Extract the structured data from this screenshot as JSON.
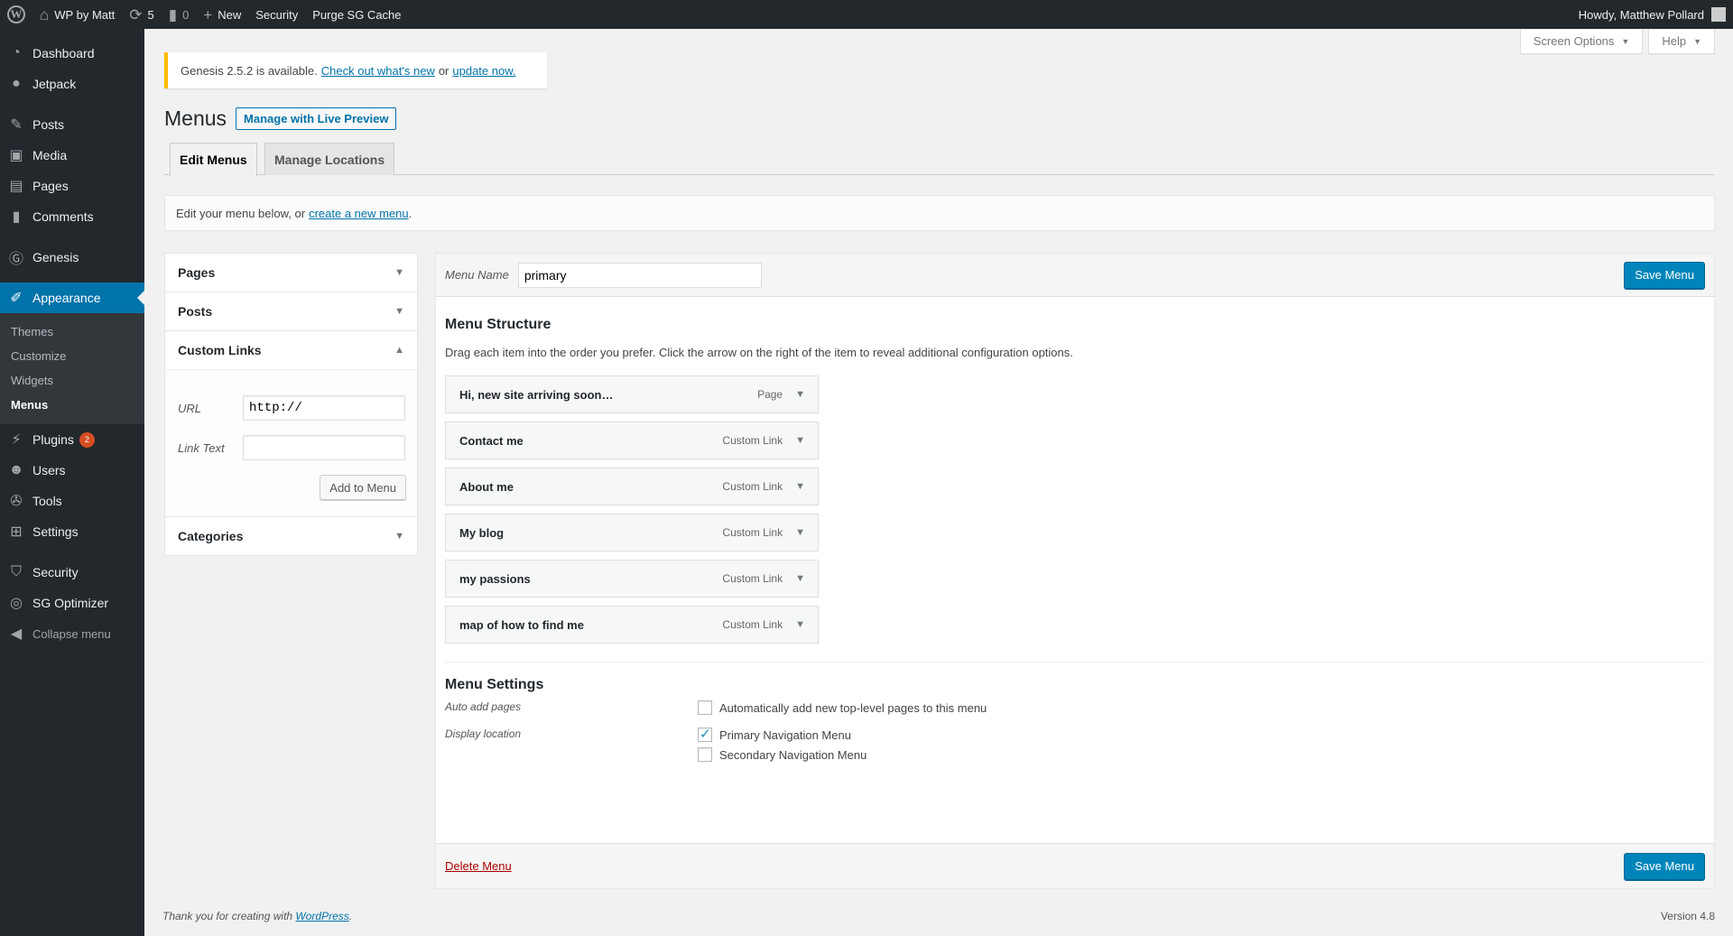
{
  "adminbar": {
    "site_name": "WP by Matt",
    "updates_count": "5",
    "comments_count": "0",
    "new_label": "New",
    "security_label": "Security",
    "purge_label": "Purge SG Cache",
    "howdy": "Howdy, Matthew Pollard"
  },
  "sidebar": {
    "dashboard": "Dashboard",
    "jetpack": "Jetpack",
    "posts": "Posts",
    "media": "Media",
    "pages": "Pages",
    "comments": "Comments",
    "genesis": "Genesis",
    "appearance": "Appearance",
    "sub_themes": "Themes",
    "sub_customize": "Customize",
    "sub_widgets": "Widgets",
    "sub_menus": "Menus",
    "plugins": "Plugins",
    "plugins_badge": "2",
    "users": "Users",
    "tools": "Tools",
    "settings": "Settings",
    "security": "Security",
    "sg_optimizer": "SG Optimizer",
    "collapse": "Collapse menu"
  },
  "screen_meta": {
    "screen_options": "Screen Options",
    "help": "Help"
  },
  "notice": {
    "text": "Genesis 2.5.2 is available.",
    "link1": "Check out what's new",
    "or": "or",
    "link2": "update now."
  },
  "page": {
    "title": "Menus",
    "live_preview": "Manage with Live Preview",
    "tab_edit": "Edit Menus",
    "tab_locations": "Manage Locations",
    "manage_text": "Edit your menu below, or",
    "manage_link": "create a new menu",
    "manage_period": "."
  },
  "accordion": {
    "pages": "Pages",
    "posts": "Posts",
    "custom_links": "Custom Links",
    "url_label": "URL",
    "url_value": "http://",
    "link_text_label": "Link Text",
    "link_text_value": "",
    "add_button": "Add to Menu",
    "categories": "Categories"
  },
  "menu_editor": {
    "name_label": "Menu Name",
    "name_value": "primary",
    "save_label": "Save Menu",
    "structure_title": "Menu Structure",
    "structure_desc": "Drag each item into the order you prefer. Click the arrow on the right of the item to reveal additional configuration options.",
    "items": [
      {
        "title": "Hi, new site arriving soon…",
        "type": "Page"
      },
      {
        "title": "Contact me",
        "type": "Custom Link"
      },
      {
        "title": "About me",
        "type": "Custom Link"
      },
      {
        "title": "My blog",
        "type": "Custom Link"
      },
      {
        "title": "my passions",
        "type": "Custom Link"
      },
      {
        "title": "map of how to find me",
        "type": "Custom Link"
      }
    ],
    "settings_title": "Menu Settings",
    "auto_add_label": "Auto add pages",
    "auto_add_option": "Automatically add new top-level pages to this menu",
    "auto_add_checked": false,
    "display_location_label": "Display location",
    "primary_nav": "Primary Navigation Menu",
    "primary_checked": true,
    "secondary_nav": "Secondary Navigation Menu",
    "secondary_checked": false,
    "delete_label": "Delete Menu"
  },
  "footer": {
    "thanks": "Thank you for creating with",
    "wp_link": "WordPress",
    "period": ".",
    "version": "Version 4.8"
  },
  "colors": {
    "admin_bg": "#23282d",
    "accent": "#0073aa",
    "primary_button": "#0085ba",
    "notice_warning": "#ffb900",
    "badge": "#d54e21",
    "delete": "#aa0000"
  }
}
